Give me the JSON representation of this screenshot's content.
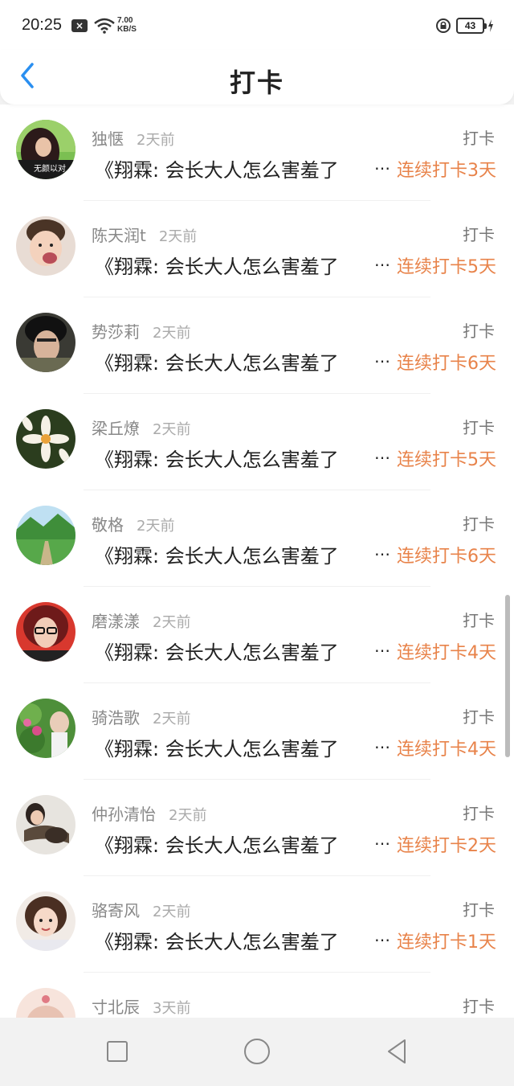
{
  "status": {
    "time": "20:25",
    "speed_value": "7.00",
    "speed_unit": "KB/S",
    "battery": "43"
  },
  "header": {
    "title": "打卡"
  },
  "feed": [
    {
      "name": "独惬",
      "time": "2天前",
      "action": "打卡",
      "text": "《翔霖: 会长大人怎么害羞了",
      "ellipsis": "…",
      "streak": "连续打卡3天",
      "avatar_caption": "无颜以对"
    },
    {
      "name": "陈天润t",
      "time": "2天前",
      "action": "打卡",
      "text": "《翔霖: 会长大人怎么害羞了",
      "ellipsis": "…",
      "streak": "连续打卡5天"
    },
    {
      "name": "势莎莉",
      "time": "2天前",
      "action": "打卡",
      "text": "《翔霖: 会长大人怎么害羞了",
      "ellipsis": "…",
      "streak": "连续打卡6天"
    },
    {
      "name": "梁丘燎",
      "time": "2天前",
      "action": "打卡",
      "text": "《翔霖: 会长大人怎么害羞了",
      "ellipsis": "…",
      "streak": "连续打卡5天"
    },
    {
      "name": "敬格",
      "time": "2天前",
      "action": "打卡",
      "text": "《翔霖: 会长大人怎么害羞了",
      "ellipsis": "…",
      "streak": "连续打卡6天"
    },
    {
      "name": "磨漾漾",
      "time": "2天前",
      "action": "打卡",
      "text": "《翔霖: 会长大人怎么害羞了",
      "ellipsis": "…",
      "streak": "连续打卡4天"
    },
    {
      "name": "骑浩歌",
      "time": "2天前",
      "action": "打卡",
      "text": "《翔霖: 会长大人怎么害羞了",
      "ellipsis": "…",
      "streak": "连续打卡4天"
    },
    {
      "name": "仲孙清怡",
      "time": "2天前",
      "action": "打卡",
      "text": "《翔霖: 会长大人怎么害羞了",
      "ellipsis": "…",
      "streak": "连续打卡2天"
    },
    {
      "name": "骆寄风",
      "time": "2天前",
      "action": "打卡",
      "text": "《翔霖: 会长大人怎么害羞了",
      "ellipsis": "…",
      "streak": "连续打卡1天"
    },
    {
      "name": "寸北辰",
      "time": "3天前",
      "action": "打卡"
    }
  ],
  "colors": {
    "accent_blue": "#2a8ff0",
    "streak_orange": "#e8834a"
  },
  "icons": {
    "back": "chevron-left-icon",
    "nav_recent": "square-icon",
    "nav_home": "circle-icon",
    "nav_back": "triangle-back-icon"
  }
}
